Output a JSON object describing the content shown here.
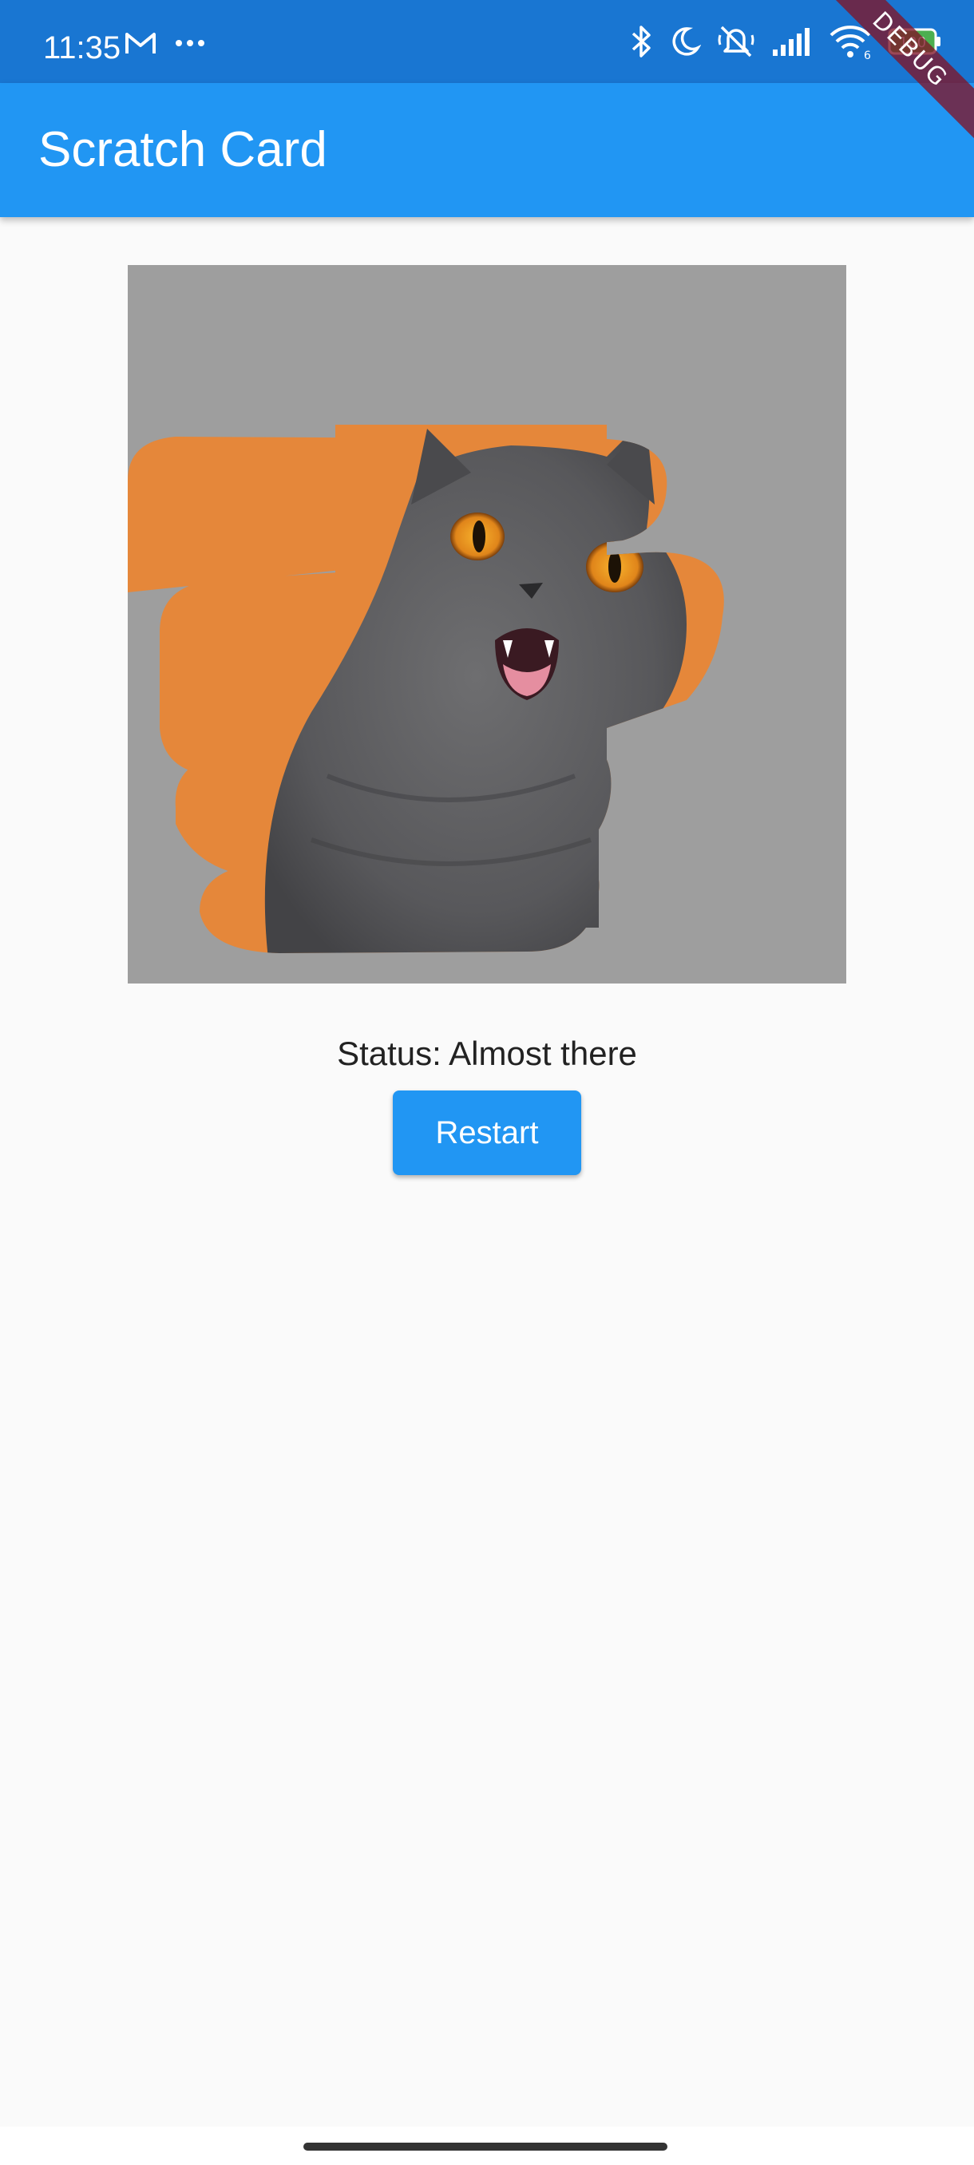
{
  "status_bar": {
    "time": "11:35",
    "battery_level": "100",
    "wifi_label": "6",
    "left_icons": [
      "gmail-icon",
      "more-dots-icon"
    ],
    "right_icons": [
      "bluetooth-icon",
      "moon-icon",
      "mute-icon",
      "signal-icon",
      "wifi-icon",
      "battery-icon"
    ]
  },
  "app_bar": {
    "title": "Scratch Card"
  },
  "debug_banner": {
    "label": "DEBUG"
  },
  "scratch_card": {
    "overlay_color": "#9e9e9e",
    "revealed_image": "grey-cat-on-orange-background"
  },
  "status": {
    "text": "Status: Almost there"
  },
  "actions": {
    "restart_label": "Restart"
  },
  "colors": {
    "status_bar": "#1976d2",
    "app_bar": "#2196f3",
    "button": "#2196f3",
    "background": "#fafafa",
    "cat_background": "#e5873a"
  }
}
